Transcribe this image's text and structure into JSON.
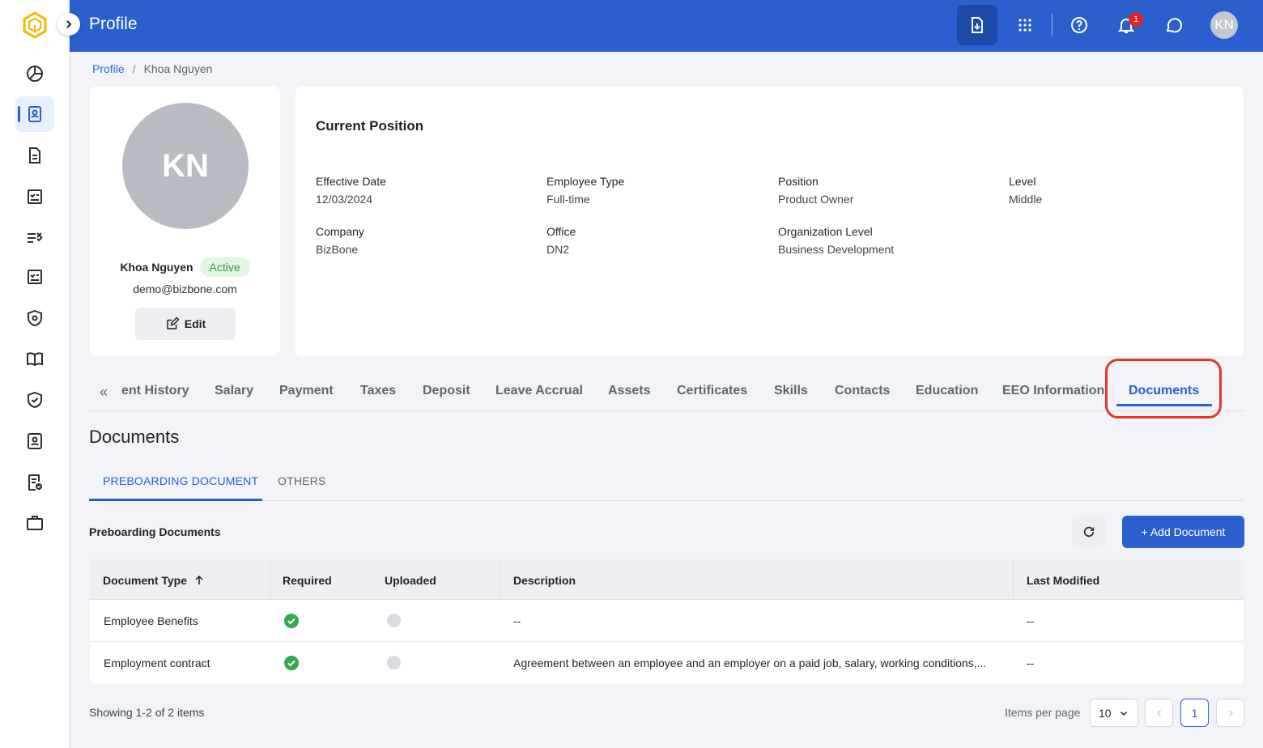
{
  "header": {
    "title": "Profile",
    "notification_count": "1",
    "user_initials": "KN"
  },
  "breadcrumb": {
    "root": "Profile",
    "separator": "/",
    "current": "Khoa Nguyen"
  },
  "profile": {
    "initials": "KN",
    "name": "Khoa Nguyen",
    "status": "Active",
    "email": "demo@bizbone.com",
    "edit_label": "Edit"
  },
  "position": {
    "title": "Current Position",
    "fields": [
      {
        "label": "Effective Date",
        "value": "12/03/2024"
      },
      {
        "label": "Employee Type",
        "value": "Full-time"
      },
      {
        "label": "Position",
        "value": "Product Owner"
      },
      {
        "label": "Level",
        "value": "Middle"
      },
      {
        "label": "Company",
        "value": "BizBone"
      },
      {
        "label": "Office",
        "value": "DN2"
      },
      {
        "label": "Organization Level",
        "value": "Business Development"
      }
    ]
  },
  "tabs": [
    {
      "label": "ent History"
    },
    {
      "label": "Salary"
    },
    {
      "label": "Payment"
    },
    {
      "label": "Taxes"
    },
    {
      "label": "Deposit"
    },
    {
      "label": "Leave Accrual"
    },
    {
      "label": "Assets"
    },
    {
      "label": "Certificates"
    },
    {
      "label": "Skills"
    },
    {
      "label": "Contacts"
    },
    {
      "label": "Education"
    },
    {
      "label": "EEO Information"
    },
    {
      "label": "Documents",
      "active": true
    }
  ],
  "documents": {
    "title": "Documents",
    "subtabs": [
      "PREBOARDING DOCUMENT",
      "OTHERS"
    ],
    "table_title": "Preboarding Documents",
    "add_label": "+ Add Document",
    "columns": [
      "Document Type",
      "Required",
      "Uploaded",
      "Description",
      "Last Modified"
    ],
    "rows": [
      {
        "type": "Employee Benefits",
        "required": true,
        "uploaded": false,
        "description": "--",
        "last_modified": "--"
      },
      {
        "type": "Employment contract",
        "required": true,
        "uploaded": false,
        "description": "Agreement between an employee and an employer on a paid job, salary, working conditions,...",
        "last_modified": "--"
      }
    ],
    "showing": "Showing 1-2 of 2 items",
    "items_per_page_label": "Items per page",
    "items_per_page": "10",
    "current_page": "1"
  },
  "colors": {
    "primary": "#2b5fce",
    "success": "#34a853",
    "highlight": "#e0382b"
  }
}
